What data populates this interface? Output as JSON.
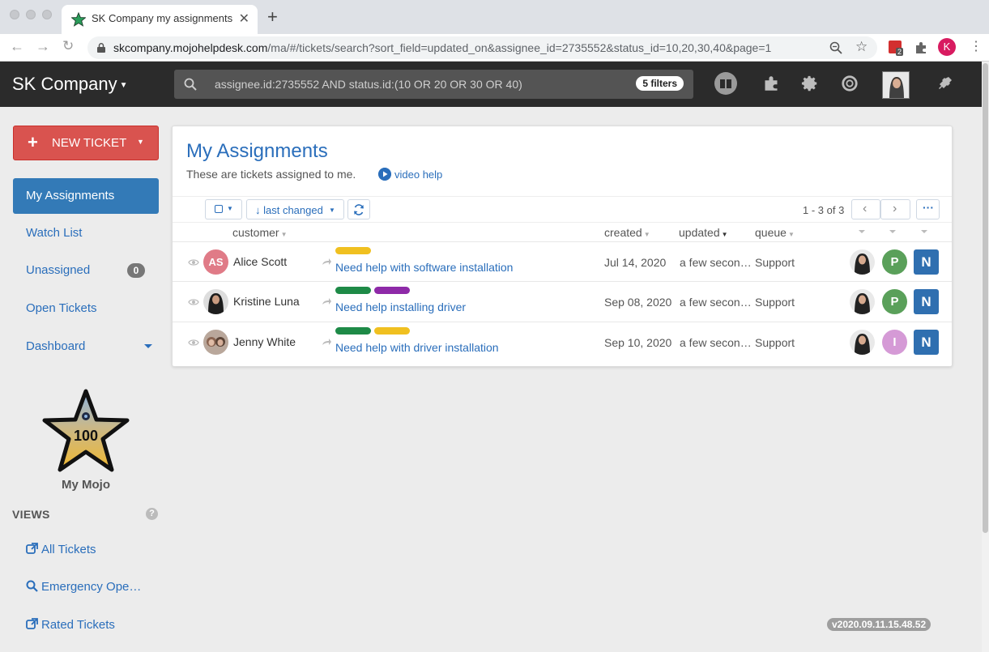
{
  "browser": {
    "tab_title": "SK Company my assignments",
    "url_host": "skcompany.mojohelpdesk.com",
    "url_path": "/ma/#/tickets/search?sort_field=updated_on&assignee_id=2735552&status_id=10,20,30,40&page=1",
    "extension_badge": "2",
    "profile_initial": "K"
  },
  "header": {
    "brand": "SK Company",
    "search_query": "assignee.id:2735552 AND status.id:(10 OR 20 OR 30 OR 40)",
    "filters_label": "5 filters"
  },
  "sidebar": {
    "new_ticket": "NEW TICKET",
    "items": [
      {
        "label": "My Assignments",
        "active": true
      },
      {
        "label": "Watch List"
      },
      {
        "label": "Unassigned",
        "badge": "0"
      },
      {
        "label": "Open Tickets"
      },
      {
        "label": "Dashboard"
      }
    ],
    "mojo_score": "100",
    "mojo_label": "My Mojo",
    "views_title": "VIEWS",
    "views": [
      {
        "label": "All Tickets",
        "icon": "external-link-icon"
      },
      {
        "label": "Emergency Ope…",
        "icon": "search-icon"
      },
      {
        "label": "Rated Tickets",
        "icon": "external-link-icon"
      }
    ]
  },
  "main": {
    "title": "My Assignments",
    "subtitle": "These are tickets assigned to me.",
    "video_help": "video help",
    "sort_label": "↓ last changed",
    "pager": "1 - 3 of 3",
    "columns": {
      "customer": "customer",
      "created": "created",
      "updated": "updated",
      "queue": "queue"
    },
    "rows": [
      {
        "customer": "Alice Scott",
        "initials": "AS",
        "subject": "Need help with software installation",
        "created": "Jul 14, 2020",
        "updated": "a few seconds ago",
        "queue": "Support",
        "priority": "P",
        "priority_color": "#5aa05a",
        "status": "N",
        "tags": [
          "#f0c020"
        ]
      },
      {
        "customer": "Kristine Luna",
        "initials": "",
        "subject": "Need help installing driver",
        "created": "Sep 08, 2020",
        "updated": "a few seconds ago",
        "queue": "Support",
        "priority": "P",
        "priority_color": "#5aa05a",
        "status": "N",
        "tags": [
          "#1e8a47",
          "#8e2aa8"
        ]
      },
      {
        "customer": "Jenny White",
        "initials": "",
        "subject": "Need help with driver installation",
        "created": "Sep 10, 2020",
        "updated": "a few seconds ago",
        "queue": "Support",
        "priority": "I",
        "priority_color": "#d59ad6",
        "status": "N",
        "tags": [
          "#1e8a47",
          "#f0c020"
        ]
      }
    ]
  },
  "version": "v2020.09.11.15.48.52",
  "colors": {
    "accent": "#337ab7",
    "link": "#2a6ebb",
    "danger": "#d9534f",
    "header_bg": "#2b2b2b"
  }
}
